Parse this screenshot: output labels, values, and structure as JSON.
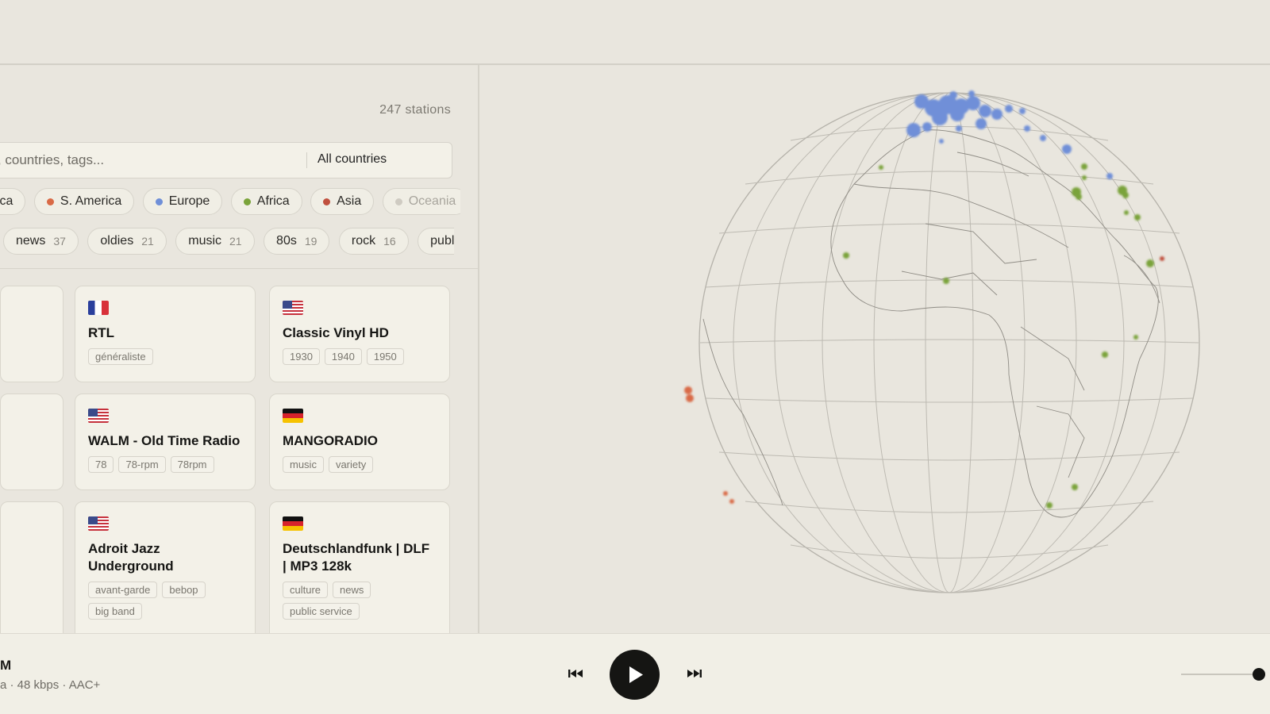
{
  "station_count": "247 stations",
  "search": {
    "placeholder": "ns, countries, tags...",
    "country_filter": "All countries"
  },
  "regions": [
    {
      "label": "ica",
      "color": null
    },
    {
      "label": "S. America",
      "color": "#d96a46"
    },
    {
      "label": "Europe",
      "color": "#6f8fd8"
    },
    {
      "label": "Africa",
      "color": "#7aa33a"
    },
    {
      "label": "Asia",
      "color": "#c0503e"
    },
    {
      "label": "Oceania",
      "color": "#cfcbc2"
    }
  ],
  "tags": [
    {
      "label": "news",
      "count": "37"
    },
    {
      "label": "oldies",
      "count": "21"
    },
    {
      "label": "music",
      "count": "21"
    },
    {
      "label": "80s",
      "count": "19"
    },
    {
      "label": "rock",
      "count": "16"
    },
    {
      "label": "publi",
      "count": ""
    }
  ],
  "stations": [
    {
      "flag": "FR",
      "name": "RTL",
      "tags": [
        "généraliste"
      ]
    },
    {
      "flag": "US",
      "name": "Classic Vinyl HD",
      "tags": [
        "1930",
        "1940",
        "1950"
      ]
    },
    {
      "flag": "US",
      "name": "WALM - Old Time Radio",
      "tags": [
        "78",
        "78-rpm",
        "78rpm"
      ]
    },
    {
      "flag": "DE",
      "name": "MANGORADIO",
      "tags": [
        "music",
        "variety"
      ]
    },
    {
      "flag": "US",
      "name": "Adroit Jazz Underground",
      "tags": [
        "avant-garde",
        "bebop",
        "big band"
      ]
    },
    {
      "flag": "DE",
      "name": "Deutschlandfunk | DLF | MP3 128k",
      "tags": [
        "culture",
        "news",
        "public service"
      ]
    }
  ],
  "player": {
    "title": "M",
    "meta": "a · 48 kbps · AAC+",
    "volume": 0.9,
    "icons": {
      "prev": "skip-previous-icon",
      "play": "play-icon",
      "next": "skip-next-icon"
    }
  },
  "colors": {
    "europe": "#6f8fd8",
    "africa": "#7aa33a",
    "s_america": "#d96a46",
    "asia": "#c0503e",
    "accent": "#151513"
  }
}
